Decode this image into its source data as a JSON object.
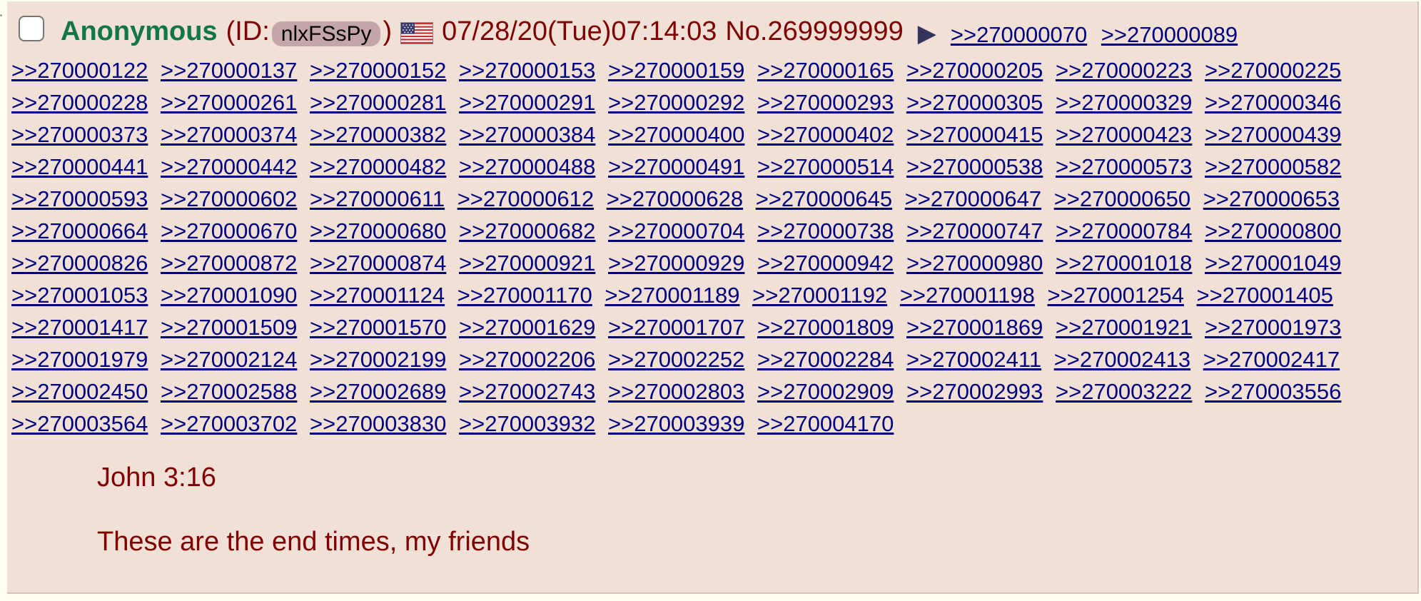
{
  "post": {
    "name": "Anonymous",
    "id_prefix": "(ID:",
    "id": "nlxFSsPy",
    "id_suffix": ")",
    "flag": "us-flag-icon",
    "datetime": "07/28/20(Tue)07:14:03",
    "number": "No.269999999",
    "menu_glyph": "▶",
    "header_replies": [
      ">>270000070",
      ">>270000089"
    ],
    "replies": [
      ">>270000122",
      ">>270000137",
      ">>270000152",
      ">>270000153",
      ">>270000159",
      ">>270000165",
      ">>270000205",
      ">>270000223",
      ">>270000225",
      ">>270000228",
      ">>270000261",
      ">>270000281",
      ">>270000291",
      ">>270000292",
      ">>270000293",
      ">>270000305",
      ">>270000329",
      ">>270000346",
      ">>270000373",
      ">>270000374",
      ">>270000382",
      ">>270000384",
      ">>270000400",
      ">>270000402",
      ">>270000415",
      ">>270000423",
      ">>270000439",
      ">>270000441",
      ">>270000442",
      ">>270000482",
      ">>270000488",
      ">>270000491",
      ">>270000514",
      ">>270000538",
      ">>270000573",
      ">>270000582",
      ">>270000593",
      ">>270000602",
      ">>270000611",
      ">>270000612",
      ">>270000628",
      ">>270000645",
      ">>270000647",
      ">>270000650",
      ">>270000653",
      ">>270000664",
      ">>270000670",
      ">>270000680",
      ">>270000682",
      ">>270000704",
      ">>270000738",
      ">>270000747",
      ">>270000784",
      ">>270000800",
      ">>270000826",
      ">>270000872",
      ">>270000874",
      ">>270000921",
      ">>270000929",
      ">>270000942",
      ">>270000980",
      ">>270001018",
      ">>270001049",
      ">>270001053",
      ">>270001090",
      ">>270001124",
      ">>270001170",
      ">>270001189",
      ">>270001192",
      ">>270001198",
      ">>270001254",
      ">>270001405",
      ">>270001417",
      ">>270001509",
      ">>270001570",
      ">>270001629",
      ">>270001707",
      ">>270001809",
      ">>270001869",
      ">>270001921",
      ">>270001973",
      ">>270001979",
      ">>270002124",
      ">>270002199",
      ">>270002206",
      ">>270002252",
      ">>270002284",
      ">>270002411",
      ">>270002413",
      ">>270002417",
      ">>270002450",
      ">>270002588",
      ">>270002689",
      ">>270002743",
      ">>270002803",
      ">>270002909",
      ">>270002993",
      ">>270003222",
      ">>270003556",
      ">>270003564",
      ">>270003702",
      ">>270003830",
      ">>270003932",
      ">>270003939",
      ">>270004170"
    ],
    "message": [
      "John 3:16",
      "These are the end times, my friends"
    ]
  },
  "colors": {
    "page_bg": "#ffffee",
    "post_bg": "#f0e0d6",
    "name": "#117743",
    "text": "#800000",
    "link": "#000080",
    "id_badge": "#c4a6aa"
  }
}
